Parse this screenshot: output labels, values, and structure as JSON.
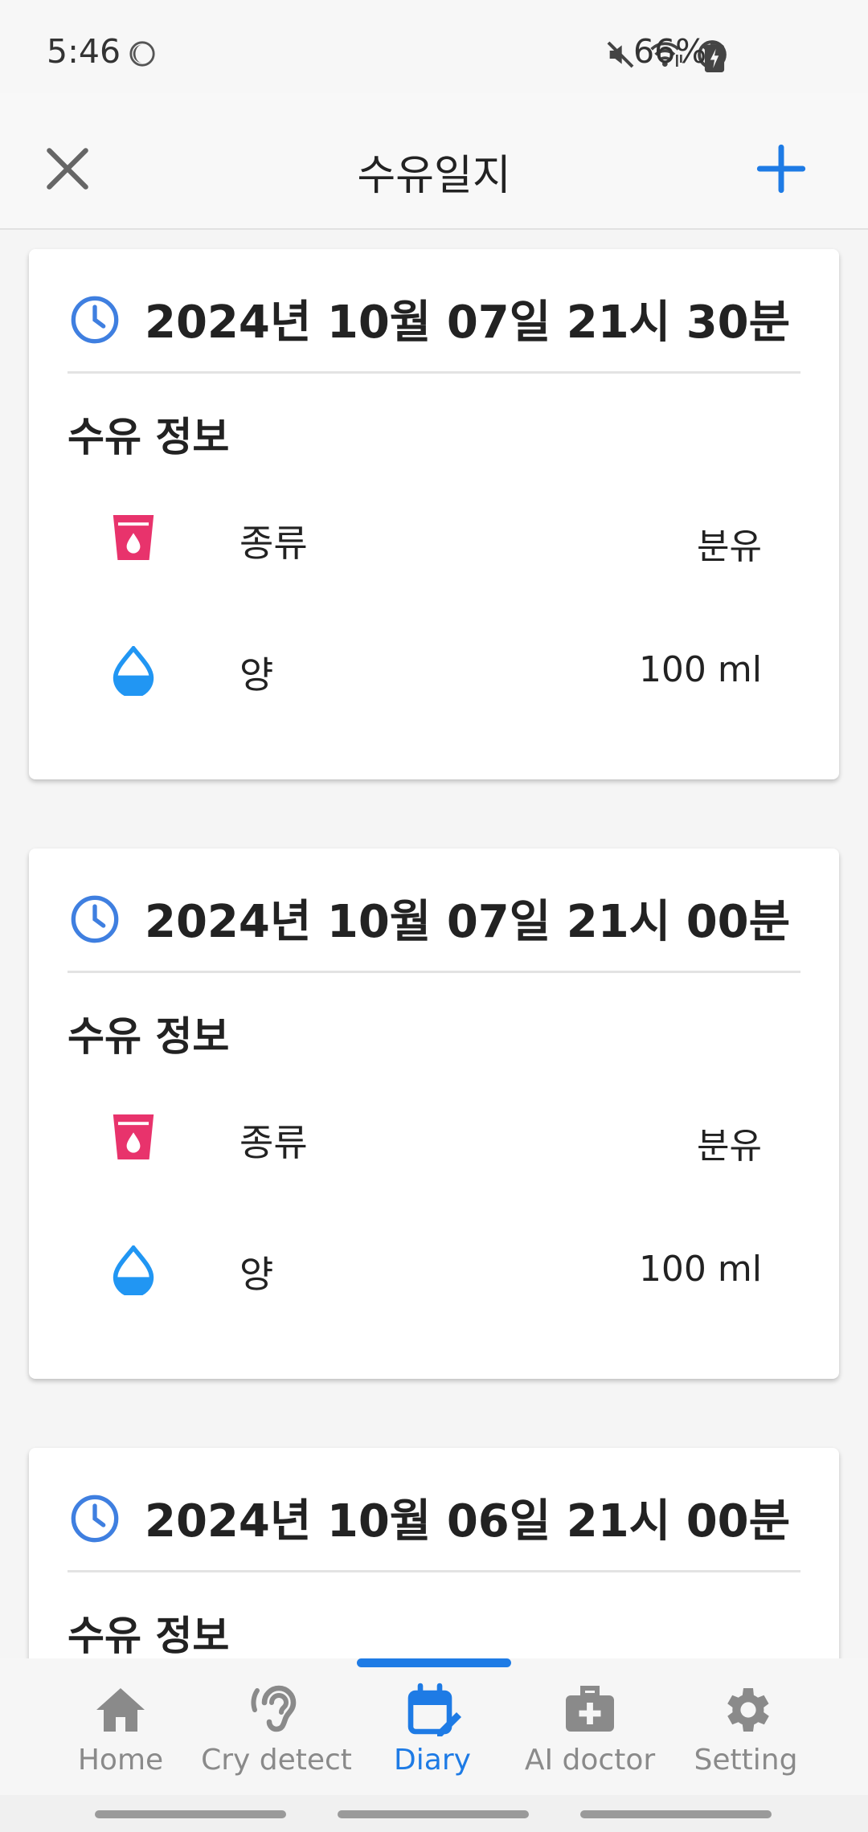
{
  "status": {
    "time": "5:46",
    "battery": "66%"
  },
  "header": {
    "title": "수유일지"
  },
  "entries": [
    {
      "datetime": "2024년 10월 07일 21시 30분",
      "section": "수유 정보",
      "type_label": "종류",
      "type_value": "분유",
      "amount_label": "양",
      "amount_value": "100 ml"
    },
    {
      "datetime": "2024년 10월 07일 21시 00분",
      "section": "수유 정보",
      "type_label": "종류",
      "type_value": "분유",
      "amount_label": "양",
      "amount_value": "100 ml"
    },
    {
      "datetime": "2024년 10월 06일 21시 00분",
      "section": "수유 정보"
    }
  ],
  "nav": [
    {
      "label": "Home",
      "icon": "home-icon"
    },
    {
      "label": "Cry detect",
      "icon": "ear-icon"
    },
    {
      "label": "Diary",
      "icon": "calendar-edit-icon",
      "active": true
    },
    {
      "label": "AI doctor",
      "icon": "medical-kit-icon"
    },
    {
      "label": "Setting",
      "icon": "gear-icon"
    }
  ],
  "colors": {
    "accent": "#1e7be5",
    "cup": "#e8336c",
    "drop": "#2196f3",
    "clock": "#3f7fe0"
  }
}
